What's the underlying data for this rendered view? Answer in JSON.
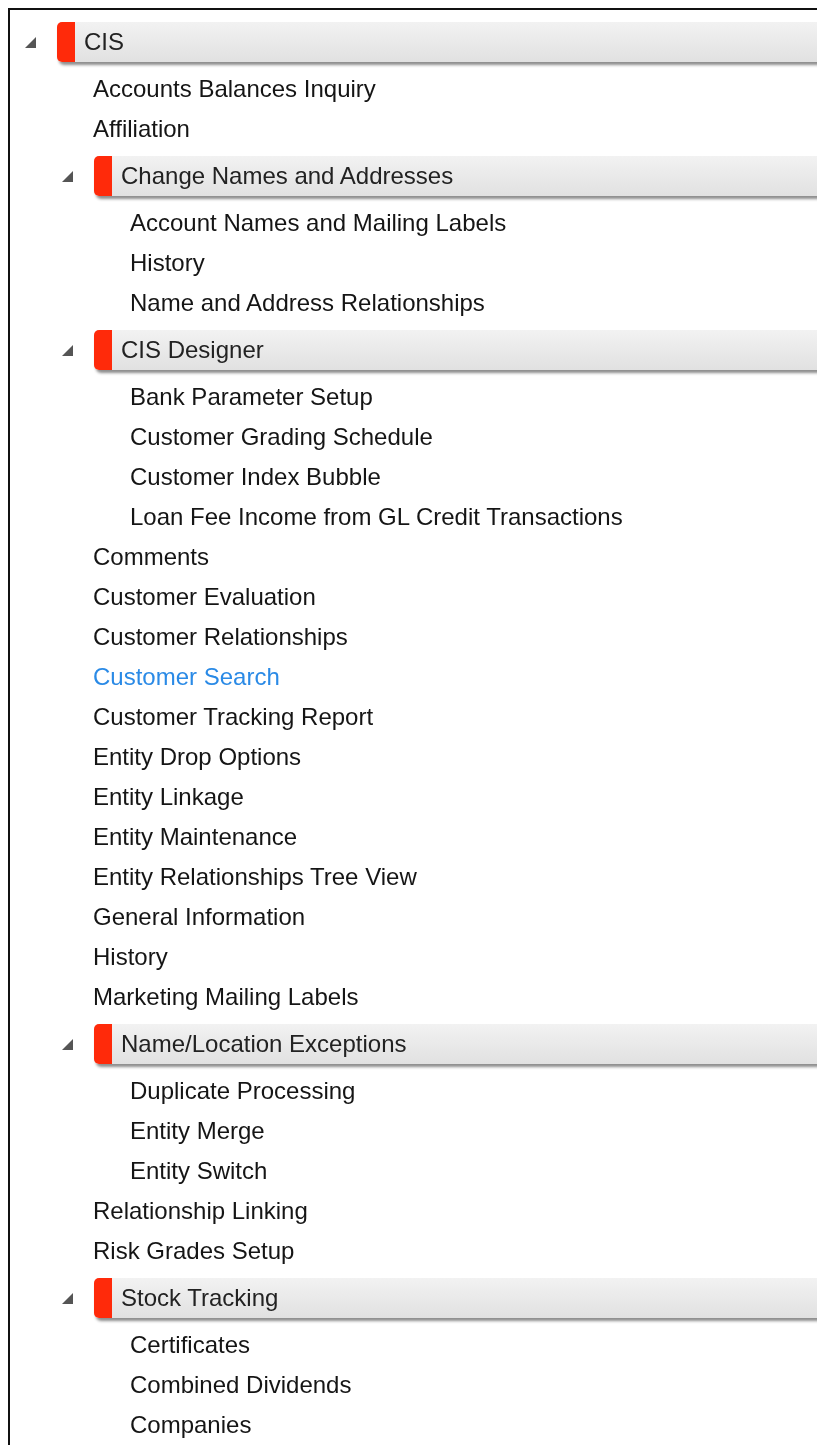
{
  "tree": {
    "kind": "group",
    "label": "CIS",
    "expanded": true,
    "children": [
      {
        "kind": "item",
        "label": "Accounts Balances Inquiry",
        "selected": false
      },
      {
        "kind": "item",
        "label": "Affiliation",
        "selected": false
      },
      {
        "kind": "group",
        "label": "Change Names and Addresses",
        "expanded": true,
        "children": [
          {
            "kind": "item",
            "label": "Account Names and Mailing Labels",
            "selected": false
          },
          {
            "kind": "item",
            "label": "History",
            "selected": false
          },
          {
            "kind": "item",
            "label": "Name and Address Relationships",
            "selected": false
          }
        ]
      },
      {
        "kind": "group",
        "label": "CIS Designer",
        "expanded": true,
        "children": [
          {
            "kind": "item",
            "label": "Bank Parameter Setup",
            "selected": false
          },
          {
            "kind": "item",
            "label": "Customer Grading Schedule",
            "selected": false
          },
          {
            "kind": "item",
            "label": "Customer Index Bubble",
            "selected": false
          },
          {
            "kind": "item",
            "label": "Loan Fee Income from GL Credit Transactions",
            "selected": false
          }
        ]
      },
      {
        "kind": "item",
        "label": "Comments",
        "selected": false
      },
      {
        "kind": "item",
        "label": "Customer Evaluation",
        "selected": false
      },
      {
        "kind": "item",
        "label": "Customer Relationships",
        "selected": false
      },
      {
        "kind": "item",
        "label": "Customer Search",
        "selected": true
      },
      {
        "kind": "item",
        "label": "Customer Tracking Report",
        "selected": false
      },
      {
        "kind": "item",
        "label": "Entity Drop Options",
        "selected": false
      },
      {
        "kind": "item",
        "label": "Entity Linkage",
        "selected": false
      },
      {
        "kind": "item",
        "label": "Entity Maintenance",
        "selected": false
      },
      {
        "kind": "item",
        "label": "Entity Relationships Tree View",
        "selected": false
      },
      {
        "kind": "item",
        "label": "General Information",
        "selected": false
      },
      {
        "kind": "item",
        "label": "History",
        "selected": false
      },
      {
        "kind": "item",
        "label": "Marketing Mailing Labels",
        "selected": false
      },
      {
        "kind": "group",
        "label": "Name/Location Exceptions",
        "expanded": true,
        "children": [
          {
            "kind": "item",
            "label": "Duplicate Processing",
            "selected": false
          },
          {
            "kind": "item",
            "label": "Entity Merge",
            "selected": false
          },
          {
            "kind": "item",
            "label": "Entity Switch",
            "selected": false
          }
        ]
      },
      {
        "kind": "item",
        "label": "Relationship Linking",
        "selected": false
      },
      {
        "kind": "item",
        "label": "Risk Grades Setup",
        "selected": false
      },
      {
        "kind": "group",
        "label": "Stock Tracking",
        "expanded": true,
        "children": [
          {
            "kind": "item",
            "label": "Certificates",
            "selected": false
          },
          {
            "kind": "item",
            "label": "Combined Dividends",
            "selected": false
          },
          {
            "kind": "item",
            "label": "Companies",
            "selected": false
          }
        ]
      }
    ]
  }
}
